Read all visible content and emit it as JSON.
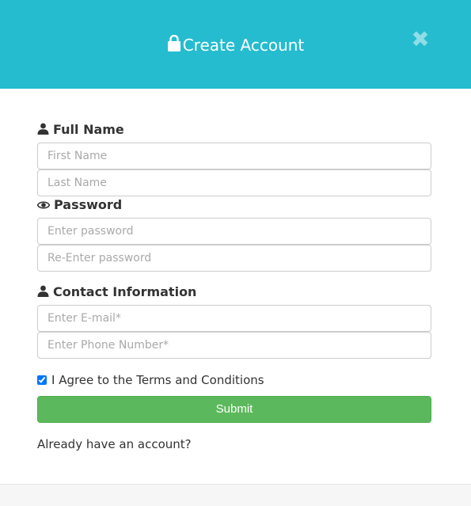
{
  "header": {
    "title": "Create Account",
    "close_symbol": "✖",
    "accent_color": "#25bccf",
    "title_icon": "lock-icon"
  },
  "form": {
    "full_name": {
      "label": "Full Name",
      "icon": "user-icon",
      "first_name_placeholder": "First Name",
      "last_name_placeholder": "Last Name"
    },
    "password": {
      "label": "Password",
      "icon": "eye-icon",
      "password_placeholder": "Enter password",
      "reenter_placeholder": "Re-Enter password"
    },
    "contact": {
      "label": "Contact Information",
      "icon": "user-icon",
      "email_placeholder": "Enter E-mail*",
      "phone_placeholder": "Enter Phone Number*"
    },
    "terms": {
      "label": "I Agree to the Terms and Conditions",
      "checked": true
    },
    "submit_label": "Submit",
    "submit_color": "#5cb85c",
    "login_prompt": "Already have an account?"
  }
}
